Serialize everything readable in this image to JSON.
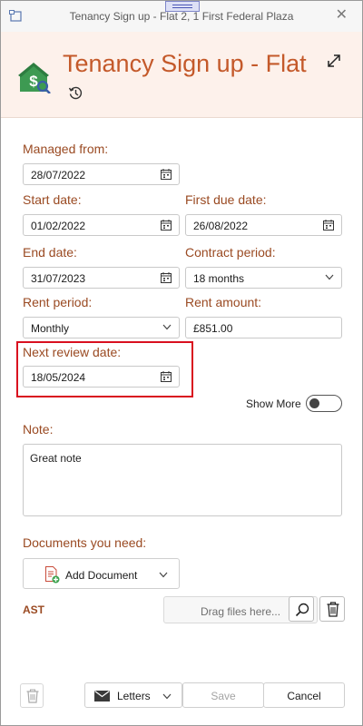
{
  "window": {
    "title": "Tenancy Sign up - Flat 2, 1 First Federal Plaza",
    "close_glyph": "✕"
  },
  "header": {
    "heading": "Tenancy Sign up - Flat",
    "icons": [
      "house-dollar-icon",
      "expand-icon",
      "history-icon"
    ]
  },
  "form": {
    "managed_from": {
      "label": "Managed from:",
      "value": "28/07/2022"
    },
    "start_date": {
      "label": "Start date:",
      "value": "01/02/2022"
    },
    "first_due_date": {
      "label": "First due date:",
      "value": "26/08/2022"
    },
    "end_date": {
      "label": "End date:",
      "value": "31/07/2023"
    },
    "contract_period": {
      "label": "Contract period:",
      "value": "18 months"
    },
    "rent_period": {
      "label": "Rent period:",
      "value": "Monthly"
    },
    "rent_amount": {
      "label": "Rent amount:",
      "value": "£851.00"
    },
    "next_review_date": {
      "label": "Next review date:",
      "value": "18/05/2024"
    },
    "show_more": {
      "label": "Show More",
      "on": false
    },
    "note": {
      "label": "Note:",
      "value": "Great note"
    }
  },
  "documents": {
    "label": "Documents you need:",
    "add_button": "Add Document",
    "ast_label": "AST",
    "drop_placeholder": "Drag files here..."
  },
  "footer": {
    "letters": "Letters",
    "save": "Save",
    "cancel": "Cancel"
  },
  "colors": {
    "accent": "#c4592a",
    "label": "#9a4a22",
    "header_bg": "#fdf1eb",
    "highlight": "#d90f1f"
  }
}
